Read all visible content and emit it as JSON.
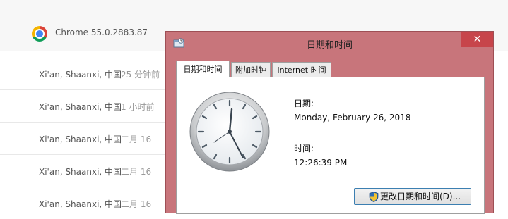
{
  "chrome": {
    "version_text": "Chrome 55.0.2883.87",
    "logo_icon": "chrome-logo-icon"
  },
  "locations": [
    {
      "name": "Xi'an, Shaanxi, 中国",
      "time": "25 分钟前"
    },
    {
      "name": "Xi'an, Shaanxi, 中国",
      "time": "1 小时前"
    },
    {
      "name": "Xi'an, Shaanxi, 中国",
      "time": "二月 16"
    },
    {
      "name": "Xi'an, Shaanxi, 中国",
      "time": "二月 16"
    },
    {
      "name": "Xi'an, Shaanxi, 中国",
      "time": "二月 16"
    }
  ],
  "dialog": {
    "title": "日期和时间",
    "close_label": "✕",
    "tabs": [
      {
        "label": "日期和时间",
        "active": true
      },
      {
        "label": "附加时钟",
        "active": false
      },
      {
        "label": "Internet 时间",
        "active": false
      }
    ],
    "date_label": "日期:",
    "date_value": "Monday, February 26, 2018",
    "time_label": "时间:",
    "time_value": "12:26:39 PM",
    "change_button_label": "更改日期和时间(D)...",
    "colors": {
      "titlebar": "#c8757b",
      "close": "#c7454b",
      "button_border": "#3c7fb1"
    }
  }
}
